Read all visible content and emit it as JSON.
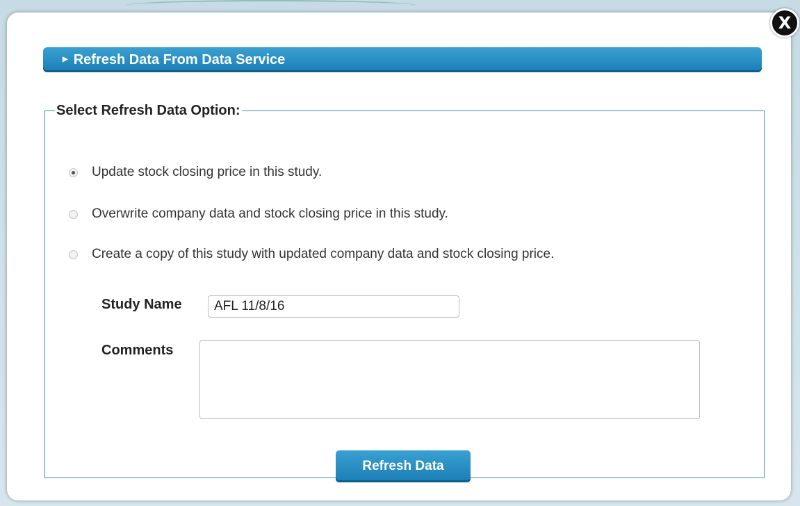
{
  "dialog": {
    "close_label": "X",
    "header_title": "Refresh Data From Data Service",
    "options_legend": "Select Refresh Data Option:",
    "options": [
      {
        "label": "Update stock closing price in this study.",
        "checked": true
      },
      {
        "label": "Overwrite company data and stock closing price in this study.",
        "checked": false
      },
      {
        "label": "Create a copy of this study with updated company data and stock closing price.",
        "checked": false
      }
    ],
    "study_name_label": "Study Name",
    "study_name_value": "AFL 11/8/16",
    "comments_label": "Comments",
    "comments_value": "",
    "refresh_button_label": "Refresh Data"
  },
  "colors": {
    "accent": "#1a7db5",
    "border": "#3b8fb8"
  },
  "icons": {
    "close": "close-icon",
    "header_arrow": "triangle-right-icon"
  }
}
